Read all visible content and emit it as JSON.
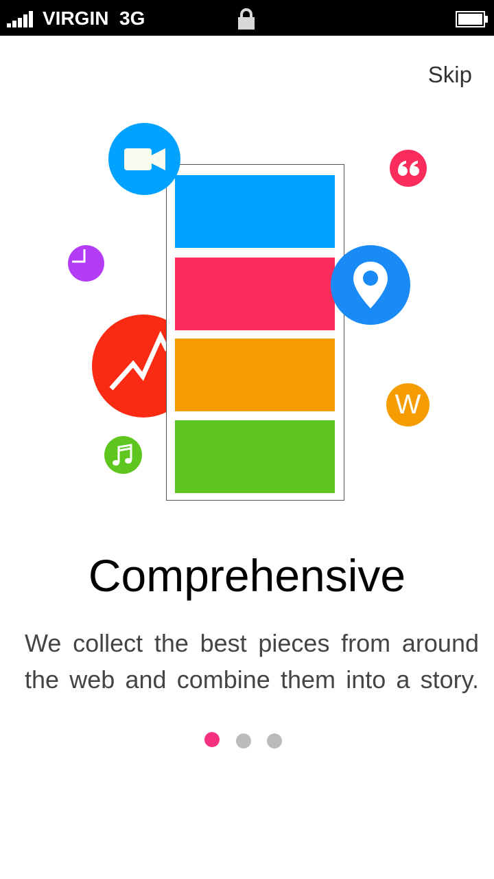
{
  "status_bar": {
    "carrier": "VIRGIN  3G",
    "network": "3G",
    "signal_icon": "signal-bars-icon",
    "lock_icon": "lock-icon",
    "battery_icon": "battery-icon"
  },
  "onboarding": {
    "skip_label": "Skip",
    "title": "Comprehensive",
    "description": "We collect the best pieces from around the web and combine them into a story.",
    "page_indicator": {
      "current": 1,
      "total": 3
    },
    "icons": [
      "video-camera-icon",
      "quote-icon",
      "pie-chart-icon",
      "location-pin-icon",
      "trend-chart-icon",
      "wikipedia-icon",
      "music-note-icon"
    ],
    "wiki_letter": "W",
    "colors": {
      "blue": "#00a2ff",
      "pink": "#f92c5c",
      "orange": "#f59d00",
      "green": "#5ec61e",
      "red": "#fb2a12",
      "purple": "#b43cf4",
      "location_blue": "#1a8bf6",
      "dot_active": "#f5317f",
      "dot_inactive": "#bbbbbb"
    }
  }
}
